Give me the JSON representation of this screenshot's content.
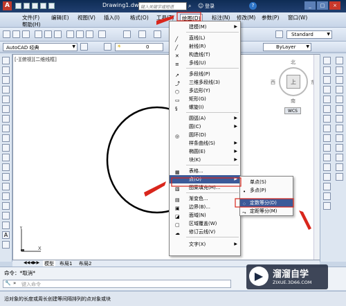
{
  "app": {
    "doc_title": "Drawing1.dwg",
    "search_placeholder": "键入关键字或短语",
    "login_label": "登录"
  },
  "menubar": [
    "文件(F)",
    "编辑(E)",
    "视图(V)",
    "插入(I)",
    "格式(O)",
    "工具(T)",
    "绘图(D)",
    "标注(N)",
    "修改(M)",
    "参数(P)",
    "窗口(W)",
    "帮助(H)"
  ],
  "toolbar": {
    "workspace": "AutoCAD 经典",
    "layer_value": "0",
    "text_style": "Standard",
    "bylayer": "ByLayer"
  },
  "viewport_label": "[-][俯视][二维线框]",
  "viewcube": {
    "north": "北",
    "south": "南",
    "east": "东",
    "west": "西",
    "top": "上",
    "wcs": "WCS"
  },
  "draw_menu": {
    "items": [
      {
        "label": "建模(M)",
        "submenu": true,
        "icon": "none"
      },
      {
        "label": "直线(L)",
        "icon": "line-icon"
      },
      {
        "label": "射线(R)",
        "icon": "ray-icon"
      },
      {
        "label": "构造线(T)",
        "icon": "xline-icon"
      },
      {
        "label": "多线(U)",
        "icon": "mline-icon"
      },
      {
        "label": "多段线(P)",
        "icon": "pline-icon"
      },
      {
        "label": "三维多段线(3)",
        "icon": "3dpoly-icon"
      },
      {
        "label": "多边形(Y)",
        "icon": "polygon-icon"
      },
      {
        "label": "矩形(G)",
        "icon": "rectangle-icon"
      },
      {
        "label": "螺旋(I)",
        "icon": "helix-icon"
      },
      {
        "label": "圆弧(A)",
        "submenu": true,
        "icon": "none"
      },
      {
        "label": "圆(C)",
        "submenu": true,
        "icon": "none"
      },
      {
        "label": "圆环(D)",
        "icon": "donut-icon"
      },
      {
        "label": "样条曲线(S)",
        "submenu": true,
        "icon": "none"
      },
      {
        "label": "椭圆(E)",
        "submenu": true,
        "icon": "none"
      },
      {
        "label": "块(K)",
        "submenu": true,
        "icon": "none"
      },
      {
        "label": "表格...",
        "icon": "table-icon"
      },
      {
        "label": "点(O)",
        "submenu": true,
        "icon": "none",
        "highlighted": true
      },
      {
        "label": "图案填充(H)...",
        "icon": "hatch-icon"
      },
      {
        "label": "渐变色...",
        "icon": "gradient-icon"
      },
      {
        "label": "边界(B)...",
        "icon": "boundary-icon"
      },
      {
        "label": "面域(N)",
        "icon": "region-icon"
      },
      {
        "label": "区域覆盖(W)",
        "icon": "wipeout-icon"
      },
      {
        "label": "修订云线(V)",
        "icon": "revcloud-icon"
      },
      {
        "label": "文字(X)",
        "submenu": true,
        "icon": "none"
      }
    ]
  },
  "point_submenu": {
    "items": [
      {
        "label": "单点(S)"
      },
      {
        "label": "多点(P)"
      },
      {
        "label": "定数等分(D)",
        "highlighted": true
      },
      {
        "label": "定距等分(M)"
      }
    ]
  },
  "tabs": [
    "模型",
    "布局1",
    "布局2"
  ],
  "command": {
    "history": "命令：*取消*",
    "prompt_placeholder": "键入命令"
  },
  "status_text": "沿对象的长度或周长创建等间隔排列的点对象或块",
  "watermark": {
    "brand": "溜溜自学",
    "url": "ZIXUE.3D66.COM"
  }
}
